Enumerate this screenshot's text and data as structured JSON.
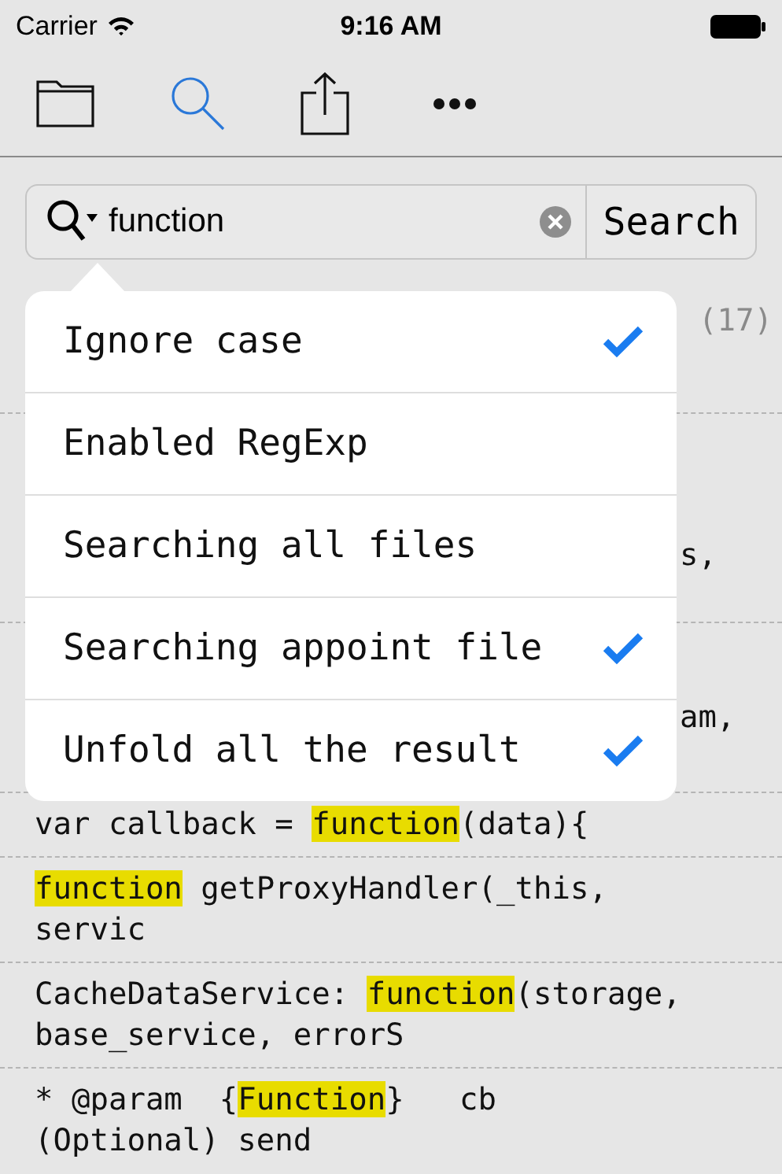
{
  "status_bar": {
    "carrier": "Carrier",
    "time": "9:16 AM"
  },
  "toolbar": [
    {
      "kind": "folder",
      "selected": false
    },
    {
      "kind": "search",
      "selected": true
    },
    {
      "kind": "share",
      "selected": false
    },
    {
      "kind": "more",
      "selected": false
    }
  ],
  "search": {
    "value": "function",
    "button": "Search"
  },
  "results": [
    {
      "kind": "header",
      "text": "(17)"
    },
    {
      "kind": "tail",
      "text": "s,"
    },
    {
      "kind": "tail",
      "text": "am,"
    },
    {
      "kind": "code",
      "segments": [
        {
          "text": "var callback = ",
          "highlight": false
        },
        {
          "text": "function",
          "highlight": true
        },
        {
          "text": "(data){",
          "highlight": false
        }
      ]
    },
    {
      "kind": "code",
      "segments": [
        {
          "text": "function",
          "highlight": true
        },
        {
          "text": " getProxyHandler(_this, servic",
          "highlight": false
        }
      ]
    },
    {
      "kind": "code",
      "segments": [
        {
          "text": "CacheDataService: ",
          "highlight": false
        },
        {
          "text": "function",
          "highlight": true
        },
        {
          "text": "(storage, base_service, errorS",
          "highlight": false
        }
      ]
    },
    {
      "kind": "code",
      "segments": [
        {
          "text": "* @param  {",
          "highlight": false
        },
        {
          "text": "Function",
          "highlight": true
        },
        {
          "text": "}   cb (Optional) send",
          "highlight": false
        }
      ]
    }
  ],
  "options": [
    {
      "label": "Ignore case",
      "checked": true
    },
    {
      "label": "Enabled RegExp",
      "checked": false
    },
    {
      "label": "Searching all files",
      "checked": false
    },
    {
      "label": "Searching appoint file",
      "checked": true
    },
    {
      "label": "Unfold all the result",
      "checked": true
    }
  ]
}
